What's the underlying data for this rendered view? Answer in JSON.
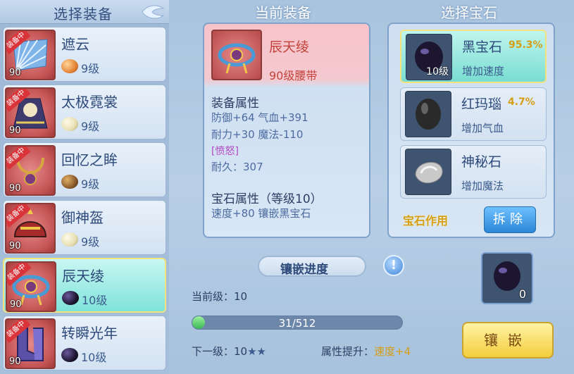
{
  "left": {
    "title": "选择装备",
    "equipped_badge": "装备中",
    "items": [
      {
        "name": "遮云",
        "level": "90",
        "gem_level": "9级",
        "gem_color": "#e48436",
        "selected": false
      },
      {
        "name": "太极霓裳",
        "level": "90",
        "gem_level": "9级",
        "gem_color": "#e7dfb2",
        "selected": false
      },
      {
        "name": "回忆之眸",
        "level": "90",
        "gem_level": "9级",
        "gem_color": "#8a5a2c",
        "selected": false
      },
      {
        "name": "御神盔",
        "level": "90",
        "gem_level": "9级",
        "gem_color": "#e7dfb2",
        "selected": false
      },
      {
        "name": "辰天绫",
        "level": "90",
        "gem_level": "10级",
        "gem_color": "#1c1630",
        "selected": true
      },
      {
        "name": "转瞬光年",
        "level": "90",
        "gem_level": "10级",
        "gem_color": "#1c1630",
        "selected": false
      }
    ]
  },
  "middle": {
    "title": "当前装备",
    "equip_name": "辰天绫",
    "equip_type": "90级腰带",
    "attr_title": "装备属性",
    "attr_line1": "防御+64 气血+391",
    "attr_line2": "耐力+30 魔法-110",
    "special": "[愤怒]",
    "durability": "耐久：307",
    "gem_attr_title": "宝石属性（等级10）",
    "gem_attr_line": "速度+80 镶嵌黑宝石"
  },
  "progress": {
    "title": "镶嵌进度",
    "info_icon": "!",
    "current_level": "当前级：10",
    "bar_text": "31/512",
    "fill_fraction": 0.0605,
    "next_level_label": "下一级：10",
    "next_level_stars": "★★",
    "boost_label": "属性提升：",
    "boost_value": "速度+4"
  },
  "right": {
    "title": "选择宝石",
    "gems": [
      {
        "name": "黑宝石",
        "percent": "95.3%",
        "desc": "增加速度",
        "count": "10级",
        "color": "#1c1630",
        "selected": true
      },
      {
        "name": "红玛瑙",
        "percent": "4.7%",
        "desc": "增加气血",
        "count": "",
        "color": "#2a2a2a",
        "selected": false
      },
      {
        "name": "神秘石",
        "percent": "",
        "desc": "增加魔法",
        "count": "",
        "color": "#c9c9c9",
        "selected": false
      }
    ],
    "effect_label": "宝石作用",
    "remove_label": "拆除",
    "slot_count": "0",
    "inlay_label": "镶嵌"
  }
}
